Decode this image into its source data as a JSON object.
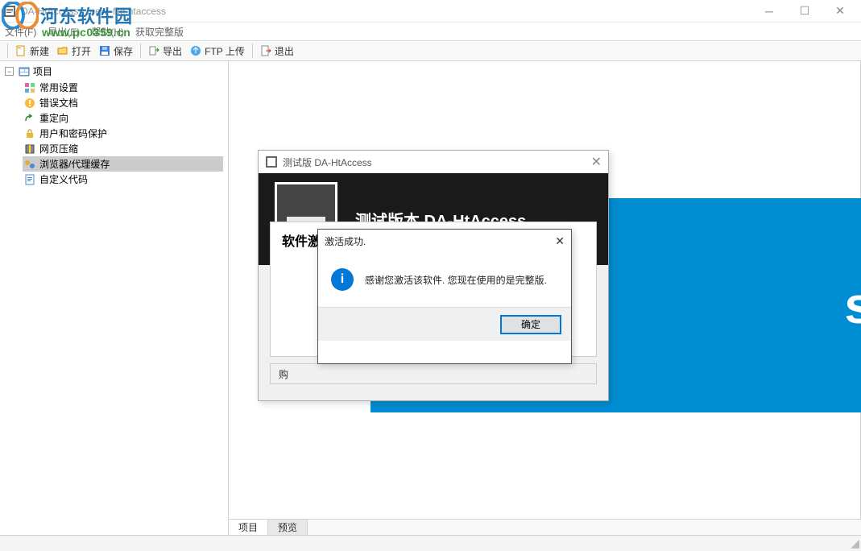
{
  "titlebar": {
    "title": "DA-HtAccess - .new_file.htaccess"
  },
  "menubar": {
    "file": "文件(F)",
    "export": "导出(E)",
    "help": "帮助(H)",
    "getfull": "获取完整版"
  },
  "toolbar": {
    "new": "新建",
    "open": "打开",
    "save": "保存",
    "export": "导出",
    "ftp": "FTP 上传",
    "exit": "退出"
  },
  "tree": {
    "root": "项目",
    "items": [
      "常用设置",
      "错误文档",
      "重定向",
      "用户和密码保护",
      "网页压缩",
      "浏览器/代理缓存",
      "自定义代码"
    ]
  },
  "bluebox": {
    "letter": "s"
  },
  "tabs": {
    "project": "项目",
    "preview": "预览"
  },
  "trial": {
    "title": "测试版 DA-HtAccess",
    "heading": "测试版本 DA-HtAccess",
    "panel_title": "软件激活",
    "buy_prefix": "购"
  },
  "msg": {
    "title": "激活成功.",
    "body": "感谢您激活该软件. 您现在使用的是完整版.",
    "ok": "确定"
  },
  "watermark": {
    "brand": "河东软件园",
    "url": "www.pc0359.cn"
  }
}
